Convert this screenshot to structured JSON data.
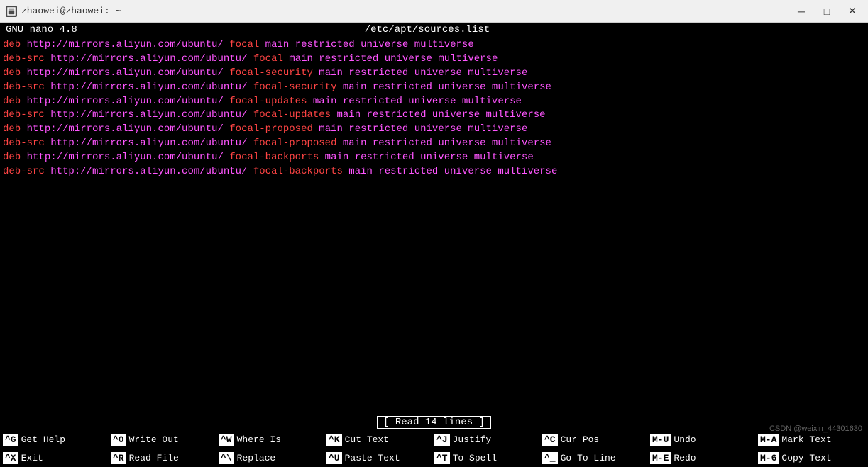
{
  "titlebar": {
    "icon": "T",
    "title": "zhaowei@zhaowei: ~",
    "min_label": "─",
    "max_label": "□",
    "close_label": "✕"
  },
  "nano_header": {
    "left": "GNU nano 4.8",
    "center": "/etc/apt/sources.list"
  },
  "editor_lines": [
    {
      "parts": [
        {
          "text": "deb ",
          "color": "red"
        },
        {
          "text": "http://mirrors.aliyun.com/ubuntu/",
          "color": "magenta"
        },
        {
          "text": " focal",
          "color": "red"
        },
        {
          "text": " main restricted universe multiverse",
          "color": "magenta"
        }
      ]
    },
    {
      "parts": [
        {
          "text": "deb-src ",
          "color": "red"
        },
        {
          "text": "http://mirrors.aliyun.com/ubuntu/",
          "color": "magenta"
        },
        {
          "text": " focal",
          "color": "red"
        },
        {
          "text": " main restricted universe multiverse",
          "color": "magenta"
        }
      ]
    },
    {
      "parts": [
        {
          "text": "",
          "color": "white"
        }
      ]
    },
    {
      "parts": [
        {
          "text": "deb ",
          "color": "red"
        },
        {
          "text": "http://mirrors.aliyun.com/ubuntu/",
          "color": "magenta"
        },
        {
          "text": " focal-security",
          "color": "red"
        },
        {
          "text": " main restricted universe multiverse",
          "color": "magenta"
        }
      ]
    },
    {
      "parts": [
        {
          "text": "deb-src ",
          "color": "red"
        },
        {
          "text": "http://mirrors.aliyun.com/ubuntu/",
          "color": "magenta"
        },
        {
          "text": " focal-security",
          "color": "red"
        },
        {
          "text": " main restricted universe multiverse",
          "color": "magenta"
        }
      ]
    },
    {
      "parts": [
        {
          "text": "",
          "color": "white"
        }
      ]
    },
    {
      "parts": [
        {
          "text": "deb ",
          "color": "red"
        },
        {
          "text": "http://mirrors.aliyun.com/ubuntu/",
          "color": "magenta"
        },
        {
          "text": " focal-updates",
          "color": "red"
        },
        {
          "text": " main restricted universe multiverse",
          "color": "magenta"
        }
      ]
    },
    {
      "parts": [
        {
          "text": "deb-src ",
          "color": "red"
        },
        {
          "text": "http://mirrors.aliyun.com/ubuntu/",
          "color": "magenta"
        },
        {
          "text": " focal-updates",
          "color": "red"
        },
        {
          "text": " main restricted universe multiverse",
          "color": "magenta"
        }
      ]
    },
    {
      "parts": [
        {
          "text": "",
          "color": "white"
        }
      ]
    },
    {
      "parts": [
        {
          "text": "deb ",
          "color": "red"
        },
        {
          "text": "http://mirrors.aliyun.com/ubuntu/",
          "color": "magenta"
        },
        {
          "text": " focal-proposed",
          "color": "red"
        },
        {
          "text": " main restricted universe multiverse",
          "color": "magenta"
        }
      ]
    },
    {
      "parts": [
        {
          "text": "deb-src ",
          "color": "red"
        },
        {
          "text": "http://mirrors.aliyun.com/ubuntu/",
          "color": "magenta"
        },
        {
          "text": " focal-proposed",
          "color": "red"
        },
        {
          "text": " main restricted universe multiverse",
          "color": "magenta"
        }
      ]
    },
    {
      "parts": [
        {
          "text": "",
          "color": "white"
        }
      ]
    },
    {
      "parts": [
        {
          "text": "deb ",
          "color": "red"
        },
        {
          "text": "http://mirrors.aliyun.com/ubuntu/",
          "color": "magenta"
        },
        {
          "text": " focal-backports",
          "color": "red"
        },
        {
          "text": " main restricted universe multiverse",
          "color": "magenta"
        }
      ]
    },
    {
      "parts": [
        {
          "text": "deb-src ",
          "color": "red"
        },
        {
          "text": "http://mirrors.aliyun.com/ubuntu/",
          "color": "magenta"
        },
        {
          "text": " focal-backports",
          "color": "red"
        },
        {
          "text": " main restricted universe multiverse",
          "color": "magenta"
        }
      ]
    }
  ],
  "status": {
    "message": "[ Read 14 lines ]"
  },
  "shortcuts": {
    "row1": [
      {
        "key": "^G",
        "label": "Get Help"
      },
      {
        "key": "^O",
        "label": "Write Out"
      },
      {
        "key": "^W",
        "label": "Where Is"
      },
      {
        "key": "^K",
        "label": "Cut Text"
      },
      {
        "key": "^J",
        "label": "Justify"
      },
      {
        "key": "^C",
        "label": "Cur Pos"
      },
      {
        "key": "M-U",
        "label": "Undo"
      },
      {
        "key": "M-A",
        "label": "Mark Text"
      }
    ],
    "row2": [
      {
        "key": "^X",
        "label": "Exit"
      },
      {
        "key": "^R",
        "label": "Read File"
      },
      {
        "key": "^\\",
        "label": "Replace"
      },
      {
        "key": "^U",
        "label": "Paste Text"
      },
      {
        "key": "^T",
        "label": "To Spell"
      },
      {
        "key": "^_",
        "label": "Go To Line"
      },
      {
        "key": "M-E",
        "label": "Redo"
      },
      {
        "key": "M-6",
        "label": "Copy Text"
      }
    ]
  },
  "watermark": {
    "text": "CSDN @weixin_44301630"
  }
}
